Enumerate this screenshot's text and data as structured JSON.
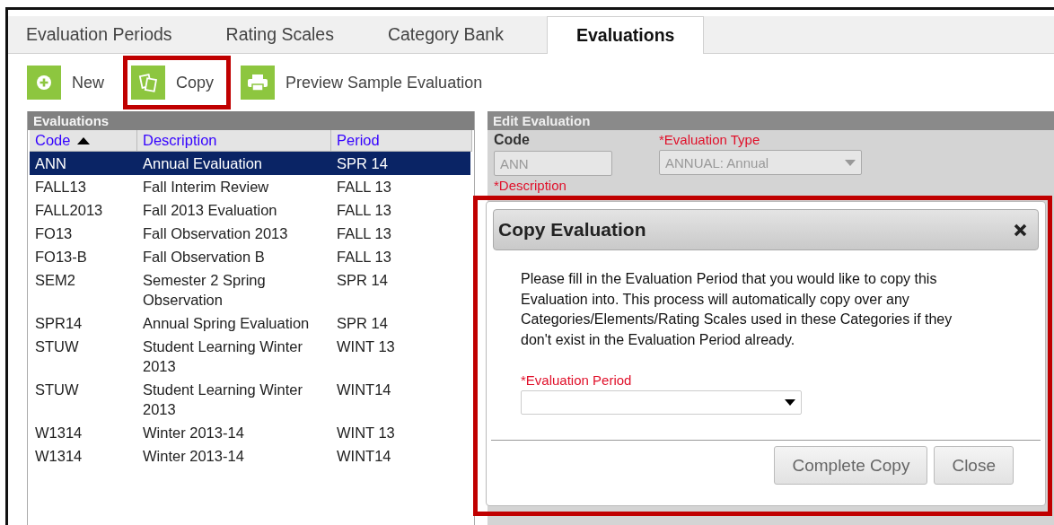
{
  "tabs": [
    {
      "label": "Evaluation Periods",
      "selected": false
    },
    {
      "label": "Rating Scales",
      "selected": false
    },
    {
      "label": "Category Bank",
      "selected": false
    },
    {
      "label": "Evaluations",
      "selected": true
    }
  ],
  "toolbar": [
    {
      "kind": "new",
      "label": "New",
      "highlighted": false
    },
    {
      "kind": "copy",
      "label": "Copy",
      "highlighted": true
    },
    {
      "kind": "print",
      "label": "Preview Sample Evaluation",
      "highlighted": false
    }
  ],
  "evaluations": {
    "title": "Evaluations",
    "columns": [
      {
        "label": "Code",
        "sorted": true
      },
      {
        "label": "Description",
        "sorted": false
      },
      {
        "label": "Period",
        "sorted": false
      }
    ],
    "rows": [
      {
        "code": "ANN",
        "description": "Annual Evaluation",
        "period": "SPR 14",
        "selected": true
      },
      {
        "code": "FALL13",
        "description": "Fall Interim Review",
        "period": "FALL 13",
        "selected": false
      },
      {
        "code": "FALL2013",
        "description": "Fall 2013 Evaluation",
        "period": "FALL 13",
        "selected": false
      },
      {
        "code": "FO13",
        "description": "Fall Observation 2013",
        "period": "FALL 13",
        "selected": false
      },
      {
        "code": "FO13-B",
        "description": "Fall Observation B",
        "period": "FALL 13",
        "selected": false
      },
      {
        "code": "SEM2",
        "description": "Semester 2 Spring Observation",
        "period": "SPR 14",
        "selected": false
      },
      {
        "code": "SPR14",
        "description": "Annual Spring Evaluation",
        "period": "SPR 14",
        "selected": false
      },
      {
        "code": "STUW",
        "description": "Student Learning Winter 2013",
        "period": "WINT 13",
        "selected": false
      },
      {
        "code": "STUW",
        "description": "Student Learning Winter 2013",
        "period": "WINT14",
        "selected": false
      },
      {
        "code": "W1314",
        "description": "Winter 2013-14",
        "period": "WINT 13",
        "selected": false
      },
      {
        "code": "W1314",
        "description": "Winter 2013-14",
        "period": "WINT14",
        "selected": false
      }
    ]
  },
  "edit_evaluation": {
    "title": "Edit Evaluation",
    "code_label": "Code",
    "code_value": "ANN",
    "type_label": "*Evaluation Type",
    "type_value": "ANNUAL: Annual",
    "description_label": "*Description"
  },
  "dialog": {
    "title": "Copy Evaluation",
    "highlighted": true,
    "message": "Please fill in the Evaluation Period that you would like to copy this Evaluation into. This process will automatically copy over any Categories/Elements/Rating Scales used in these Categories if they don't exist in the Evaluation Period already.",
    "period_label": "*Evaluation Period",
    "buttons": [
      "Complete Copy",
      "Close"
    ]
  }
}
